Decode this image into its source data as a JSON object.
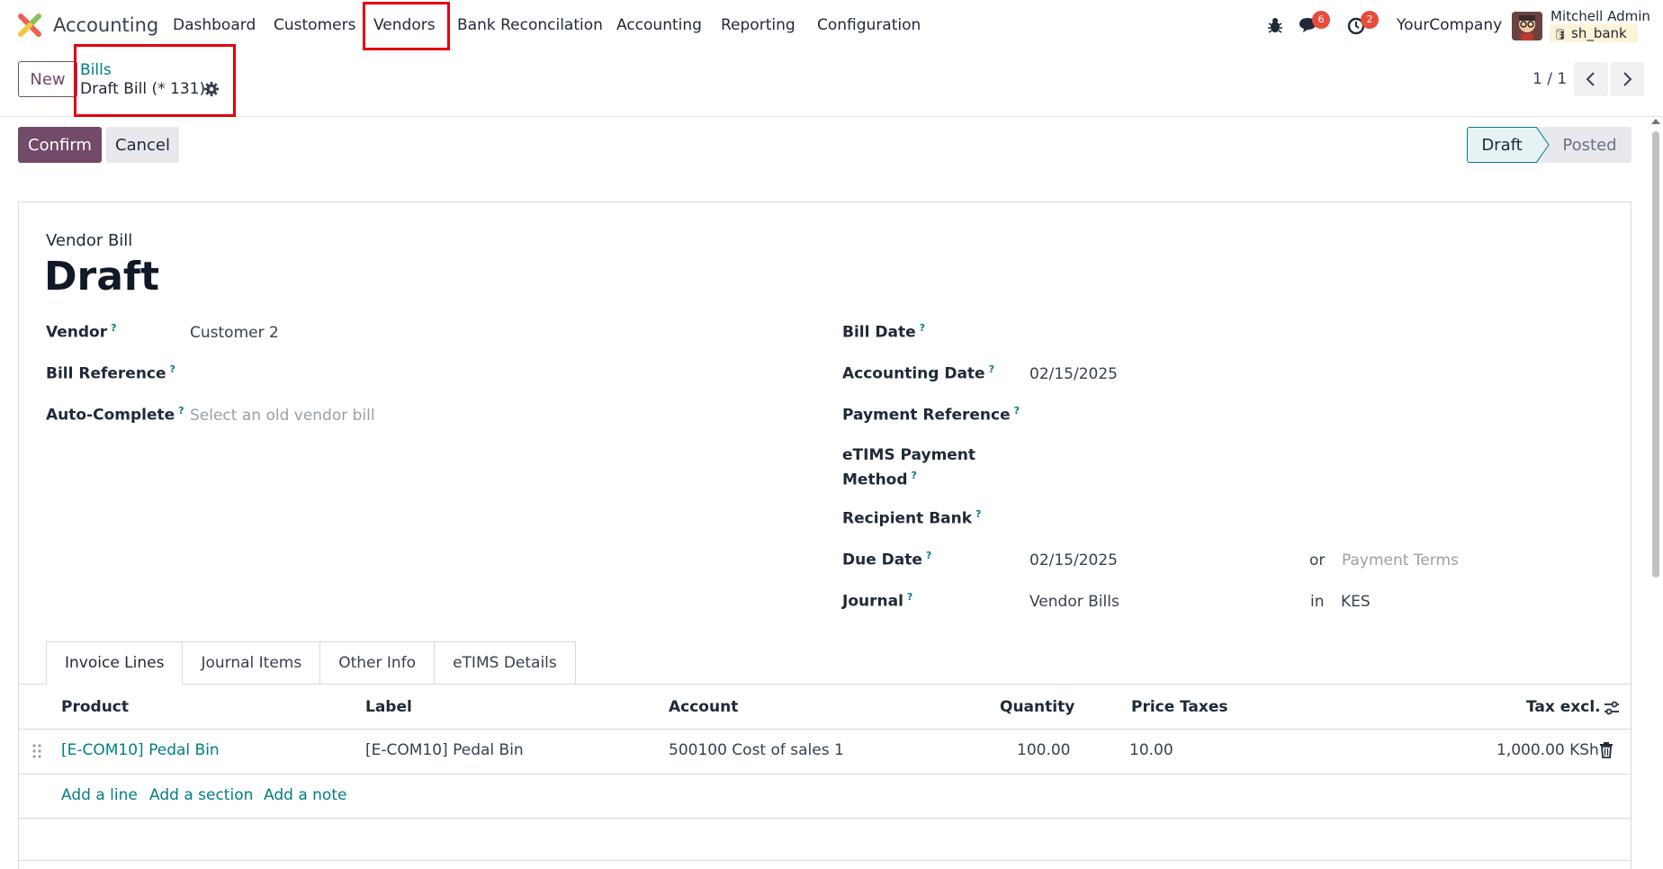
{
  "navbar": {
    "app_name": "Accounting",
    "menu": [
      "Dashboard",
      "Customers",
      "Vendors",
      "Bank Reconcilation",
      "Accounting",
      "Reporting",
      "Configuration"
    ],
    "messages_badge": "6",
    "activities_badge": "2",
    "company": "YourCompany",
    "user_name": "Mitchell Admin",
    "database": "sh_bank"
  },
  "control_panel": {
    "new_label": "New",
    "breadcrumb_parent": "Bills",
    "breadcrumb_current": "Draft Bill (* 131)",
    "pager": "1 / 1"
  },
  "actions": {
    "confirm_label": "Confirm",
    "cancel_label": "Cancel"
  },
  "status": {
    "stages": [
      "Draft",
      "Posted"
    ],
    "current": "Draft"
  },
  "form": {
    "subtitle": "Vendor Bill",
    "title": "Draft",
    "left": {
      "vendor_label": "Vendor",
      "vendor_value": "Customer 2",
      "bill_reference_label": "Bill Reference",
      "auto_complete_label": "Auto-Complete",
      "auto_complete_placeholder": "Select an old vendor bill"
    },
    "right": {
      "bill_date_label": "Bill Date",
      "accounting_date_label": "Accounting Date",
      "accounting_date_value": "02/15/2025",
      "payment_reference_label": "Payment Reference",
      "etims_payment_label_1": "eTIMS Payment",
      "etims_payment_label_2": "Method",
      "recipient_bank_label": "Recipient Bank",
      "due_date_label": "Due Date",
      "due_date_value": "02/15/2025",
      "or_label": "or",
      "payment_terms_placeholder": "Payment Terms",
      "journal_label": "Journal",
      "journal_value": "Vendor Bills",
      "in_label": "in",
      "currency_value": "KES"
    },
    "help_mark": "?"
  },
  "tabs": [
    "Invoice Lines",
    "Journal Items",
    "Other Info",
    "eTIMS Details"
  ],
  "table": {
    "headers": {
      "product": "Product",
      "label": "Label",
      "account": "Account",
      "quantity": "Quantity",
      "price": "Price",
      "taxes": "Taxes",
      "tax_excl": "Tax excl."
    },
    "rows": [
      {
        "product": "[E-COM10] Pedal Bin",
        "label": "[E-COM10] Pedal Bin",
        "account": "500100 Cost of sales 1",
        "quantity": "100.00",
        "price": "10.00",
        "taxes": "",
        "tax_excl": "1,000.00 KSh"
      }
    ],
    "add_line": "Add a line",
    "add_section": "Add a section",
    "add_note": "Add a note"
  },
  "colors": {
    "brand": "#714b67",
    "link": "#017e84",
    "highlight": "#e3000f",
    "badge": "#e74c3c"
  }
}
